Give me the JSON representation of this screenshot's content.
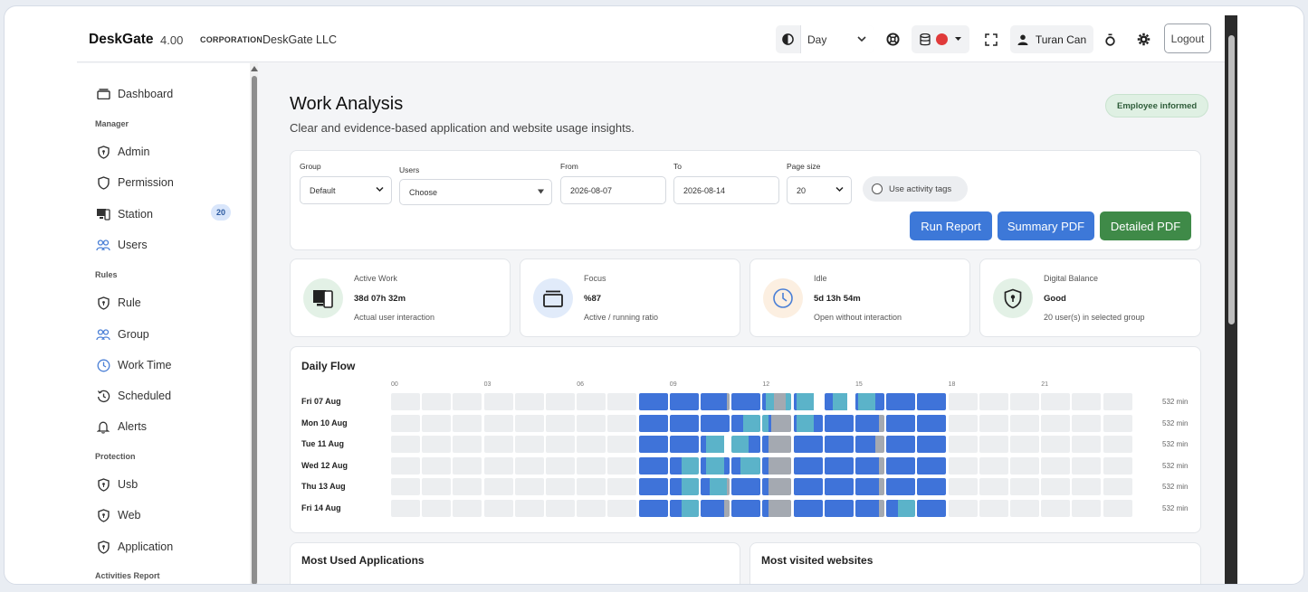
{
  "header": {
    "brand": "DeskGate",
    "version": "4.00",
    "corp_label": "CORPORATION",
    "corp_name": "DeskGate LLC",
    "period_value": "Day",
    "user_name": "Turan Can",
    "logout_label": "Logout",
    "status_color": "#e03a3a"
  },
  "sidebar": {
    "dashboard": "Dashboard",
    "sections": {
      "manager": "Manager",
      "rules": "Rules",
      "protection": "Protection",
      "activities": "Activities Report"
    },
    "items": {
      "admin": "Admin",
      "permission": "Permission",
      "station": "Station",
      "station_badge": "20",
      "users": "Users",
      "rule": "Rule",
      "group": "Group",
      "work_time": "Work Time",
      "scheduled": "Scheduled",
      "alerts": "Alerts",
      "usb": "Usb",
      "web": "Web",
      "application": "Application"
    }
  },
  "page": {
    "title": "Work Analysis",
    "subtitle": "Clear and evidence-based application and website usage insights.",
    "informed_badge": "Employee informed"
  },
  "filters": {
    "group_label": "Group",
    "group_value": "Default",
    "users_label": "Users",
    "users_value": "Choose",
    "from_label": "From",
    "from_value": "2026-08-07",
    "to_label": "To",
    "to_value": "2026-08-14",
    "page_size_label": "Page size",
    "page_size_value": "20",
    "activity_tags_label": "Use activity tags"
  },
  "actions": {
    "run_report": "Run Report",
    "summary_pdf": "Summary PDF",
    "detailed_pdf": "Detailed PDF",
    "run_color": "#3d78d8",
    "summary_color": "#3d78d8",
    "detailed_color": "#3f8a48"
  },
  "stats": [
    {
      "title": "Active Work",
      "value": "38d 07h 32m",
      "sub": "Actual user interaction",
      "icon": "device-icon"
    },
    {
      "title": "Focus",
      "value": "%87",
      "sub": "Active / running ratio",
      "icon": "window-icon"
    },
    {
      "title": "Idle",
      "value": "5d 13h 54m",
      "sub": "Open without interaction",
      "icon": "clock-icon"
    },
    {
      "title": "Digital Balance",
      "value": "Good",
      "sub": "20 user(s) in selected group",
      "icon": "shield-icon"
    }
  ],
  "daily_flow": {
    "title": "Daily Flow",
    "hour_labels": [
      "00",
      "03",
      "06",
      "09",
      "12",
      "15",
      "18",
      "21"
    ],
    "colors": {
      "active": "#3f73d9",
      "focus": "#5bb3c9",
      "idle": "#a4a9b1",
      "empty": "#eceef0"
    },
    "rows": [
      {
        "day": "Fri 07 Aug",
        "total": "532 min",
        "cells": [
          "e",
          "e",
          "e",
          "e",
          "e",
          "e",
          "e",
          "e",
          "a",
          "a",
          "a9i1",
          "a",
          "a1f3i4f2",
          "a1f6",
          "a3f5",
          "a1f6a3",
          "a",
          "a",
          "e",
          "e",
          "e",
          "e",
          "e",
          "e"
        ]
      },
      {
        "day": "Mon 10 Aug",
        "total": "532 min",
        "cells": [
          "e",
          "e",
          "e",
          "e",
          "e",
          "e",
          "e",
          "e",
          "a",
          "a",
          "a",
          "a4f6",
          "f2a1i7",
          "a1f6a3",
          "a",
          "a8i2",
          "a",
          "a",
          "e",
          "e",
          "e",
          "e",
          "e",
          "e"
        ]
      },
      {
        "day": "Tue 11 Aug",
        "total": "532 min",
        "cells": [
          "e",
          "e",
          "e",
          "e",
          "e",
          "e",
          "e",
          "e",
          "a",
          "a",
          "a2f6",
          "f6a4",
          "a2i8",
          "a",
          "a",
          "a7i3",
          "a",
          "a",
          "e",
          "e",
          "e",
          "e",
          "e",
          "e"
        ]
      },
      {
        "day": "Wed 12 Aug",
        "total": "532 min",
        "cells": [
          "e",
          "e",
          "e",
          "e",
          "e",
          "e",
          "e",
          "e",
          "a",
          "a4f6",
          "a2f6a2",
          "a3f7",
          "a2i8",
          "a",
          "a",
          "a8i2",
          "a",
          "a",
          "e",
          "e",
          "e",
          "e",
          "e",
          "e"
        ]
      },
      {
        "day": "Thu 13 Aug",
        "total": "532 min",
        "cells": [
          "e",
          "e",
          "e",
          "e",
          "e",
          "e",
          "e",
          "e",
          "a",
          "a4f6",
          "a3f6i1",
          "a",
          "a2i8",
          "a",
          "a",
          "a8i2",
          "a",
          "a",
          "e",
          "e",
          "e",
          "e",
          "e",
          "e"
        ]
      },
      {
        "day": "Fri 14 Aug",
        "total": "532 min",
        "cells": [
          "e",
          "e",
          "e",
          "e",
          "e",
          "e",
          "e",
          "e",
          "a",
          "a4f6",
          "a8i2",
          "a",
          "a2i8",
          "a",
          "a",
          "a8i2",
          "a4f6",
          "a",
          "e",
          "e",
          "e",
          "e",
          "e",
          "e"
        ]
      }
    ]
  },
  "bottom": {
    "apps_title": "Most Used Applications",
    "websites_title": "Most visited websites"
  }
}
